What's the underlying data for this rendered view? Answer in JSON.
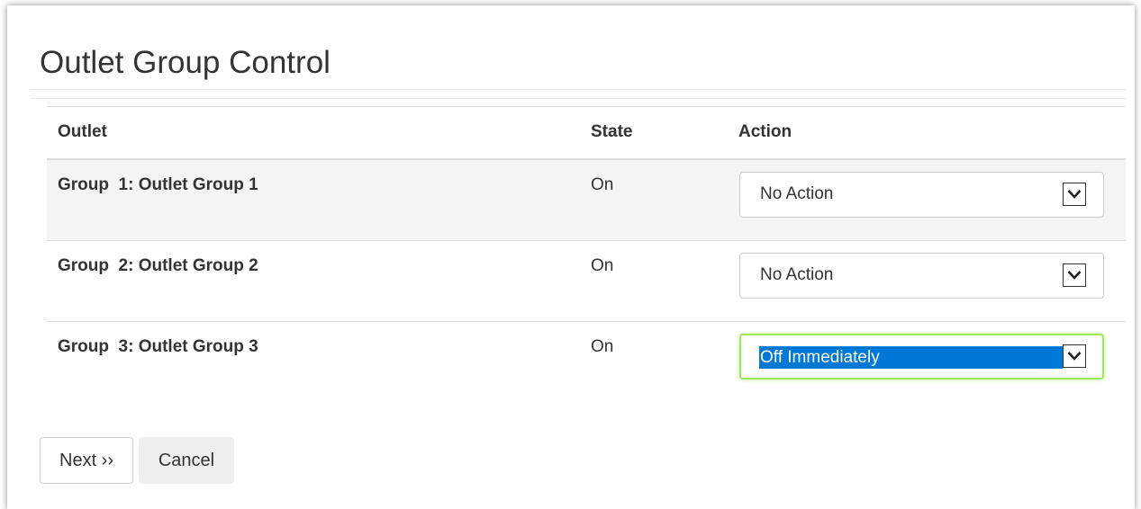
{
  "page": {
    "title": "Outlet Group Control"
  },
  "table": {
    "headers": {
      "outlet": "Outlet",
      "state": "State",
      "action": "Action"
    },
    "rows": [
      {
        "outlet": "Group  1: Outlet Group 1",
        "state": "On",
        "action": "No Action",
        "focused": false
      },
      {
        "outlet": "Group  2: Outlet Group 2",
        "state": "On",
        "action": "No Action",
        "focused": false
      },
      {
        "outlet": "Group  3: Outlet Group 3",
        "state": "On",
        "action": "Off Immediately",
        "focused": true
      }
    ]
  },
  "buttons": {
    "next_label": "Next ››",
    "cancel_label": "Cancel"
  },
  "icons": {
    "dropdown": "chevron-down-icon"
  },
  "colors": {
    "selection_highlight": "#0078d7",
    "focus_border": "#9fe85a",
    "shaded_row": "#f5f5f5",
    "text": "#333333"
  }
}
